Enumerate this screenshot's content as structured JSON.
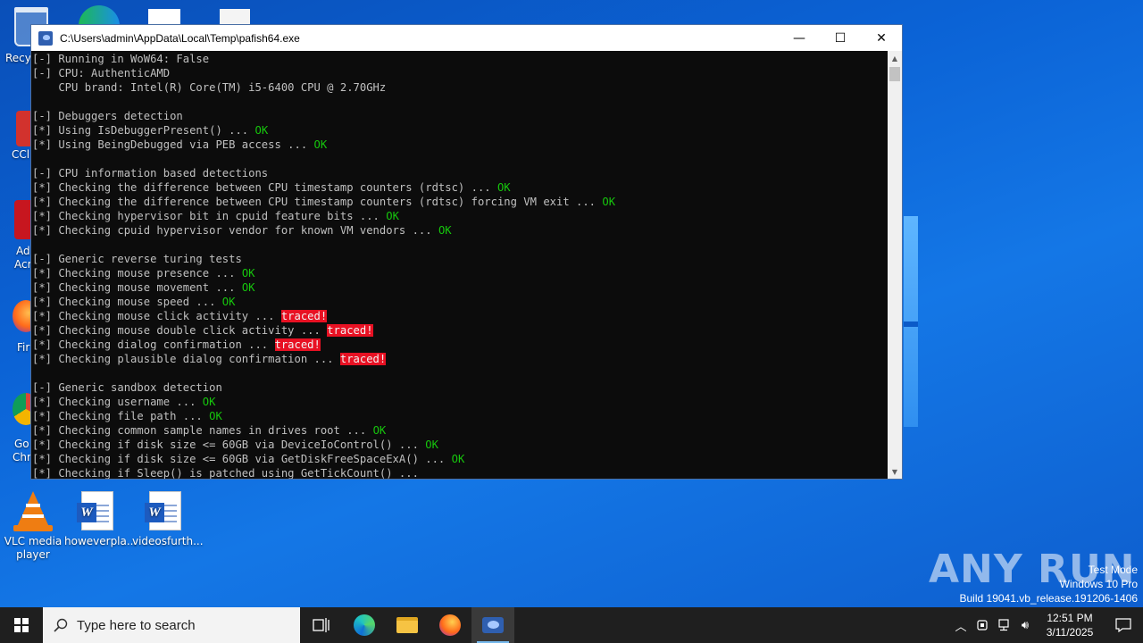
{
  "window": {
    "title": "C:\\Users\\admin\\AppData\\Local\\Temp\\pafish64.exe",
    "minimize_glyph": "—",
    "maximize_glyph": "☐",
    "close_glyph": "✕"
  },
  "console_lines": [
    {
      "text": "[-] Running in WoW64: False"
    },
    {
      "text": "[-] CPU: AuthenticAMD"
    },
    {
      "text": "    CPU brand: Intel(R) Core(TM) i5-6400 CPU @ 2.70GHz"
    },
    {
      "text": ""
    },
    {
      "text": "[-] Debuggers detection"
    },
    {
      "text": "[*] Using IsDebuggerPresent() ... ",
      "result": "OK"
    },
    {
      "text": "[*] Using BeingDebugged via PEB access ... ",
      "result": "OK"
    },
    {
      "text": ""
    },
    {
      "text": "[-] CPU information based detections"
    },
    {
      "text": "[*] Checking the difference between CPU timestamp counters (rdtsc) ... ",
      "result": "OK"
    },
    {
      "text": "[*] Checking the difference between CPU timestamp counters (rdtsc) forcing VM exit ... ",
      "result": "OK"
    },
    {
      "text": "[*] Checking hypervisor bit in cpuid feature bits ... ",
      "result": "OK"
    },
    {
      "text": "[*] Checking cpuid hypervisor vendor for known VM vendors ... ",
      "result": "OK"
    },
    {
      "text": ""
    },
    {
      "text": "[-] Generic reverse turing tests"
    },
    {
      "text": "[*] Checking mouse presence ... ",
      "result": "OK"
    },
    {
      "text": "[*] Checking mouse movement ... ",
      "result": "OK"
    },
    {
      "text": "[*] Checking mouse speed ... ",
      "result": "OK"
    },
    {
      "text": "[*] Checking mouse click activity ... ",
      "result": "traced!"
    },
    {
      "text": "[*] Checking mouse double click activity ... ",
      "result": "traced!"
    },
    {
      "text": "[*] Checking dialog confirmation ... ",
      "result": "traced!"
    },
    {
      "text": "[*] Checking plausible dialog confirmation ... ",
      "result": "traced!",
      "cursor": true
    },
    {
      "text": ""
    },
    {
      "text": "[-] Generic sandbox detection"
    },
    {
      "text": "[*] Checking username ... ",
      "result": "OK"
    },
    {
      "text": "[*] Checking file path ... ",
      "result": "OK"
    },
    {
      "text": "[*] Checking common sample names in drives root ... ",
      "result": "OK"
    },
    {
      "text": "[*] Checking if disk size <= 60GB via DeviceIoControl() ... ",
      "result": "OK"
    },
    {
      "text": "[*] Checking if disk size <= 60GB via GetDiskFreeSpaceExA() ... ",
      "result": "OK"
    },
    {
      "text": "[*] Checking if Sleep() is patched using GetTickCount() ... "
    }
  ],
  "desktop_icons": {
    "recycle_partial": "Recy",
    "ccleaner_partial": "CCl",
    "acrobat_partial_1": "Ad",
    "acrobat_partial_2": "Acr",
    "firefox_partial": "Fir",
    "chrome_partial_1": "Go",
    "chrome_partial_2": "Chr",
    "vlc_label": "VLC media player",
    "doc1_label": "howeverpla...",
    "doc2_label": "videosfurth..."
  },
  "watermark": "ANY RUN",
  "system_info": {
    "line1": "Test Mode",
    "line2": "Windows 10 Pro",
    "line3": "Build 19041.vb_release.191206-1406"
  },
  "taskbar": {
    "search_placeholder": "Type here to search",
    "time": "12:51 PM",
    "date": "3/11/2025"
  },
  "colors": {
    "ok": "#16c60c",
    "traced_bg": "#e81123",
    "console_text": "#c0c0c0",
    "console_bg": "#0c0c0c"
  }
}
